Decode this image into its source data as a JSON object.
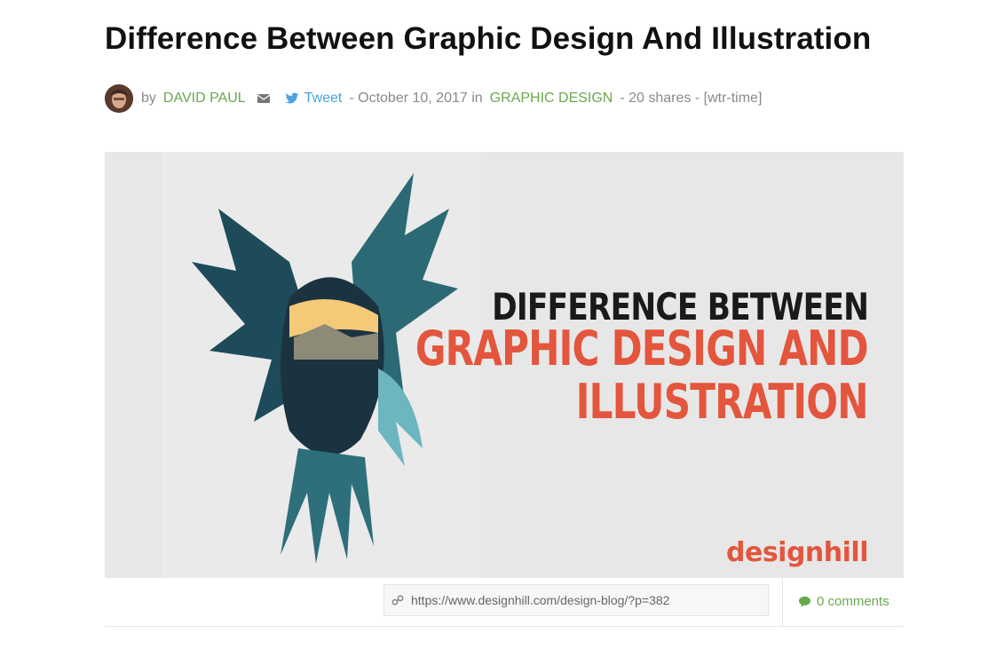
{
  "post": {
    "title": "Difference Between Graphic Design And Illustration",
    "meta": {
      "by": "by",
      "author": "DAVID PAUL",
      "tweet": "Tweet",
      "date_text": "- October 10, 2017 in",
      "category": "GRAPHIC DESIGN",
      "shares": "- 20 shares - [wtr-time]"
    }
  },
  "hero": {
    "line1": "DIFFERENCE BETWEEN",
    "line2": "GRAPHIC DESIGN AND",
    "line3": "ILLUSTRATION",
    "logo": "designhill"
  },
  "share": {
    "url": "https://www.designhill.com/design-blog/?p=382",
    "comments": "0 comments"
  },
  "colors": {
    "accent_green": "#6aa84f",
    "twitter_blue": "#4aa3df",
    "hero_red": "#e3553c"
  },
  "icons": [
    "avatar",
    "envelope-icon",
    "twitter-icon",
    "link-icon",
    "comment-icon"
  ]
}
